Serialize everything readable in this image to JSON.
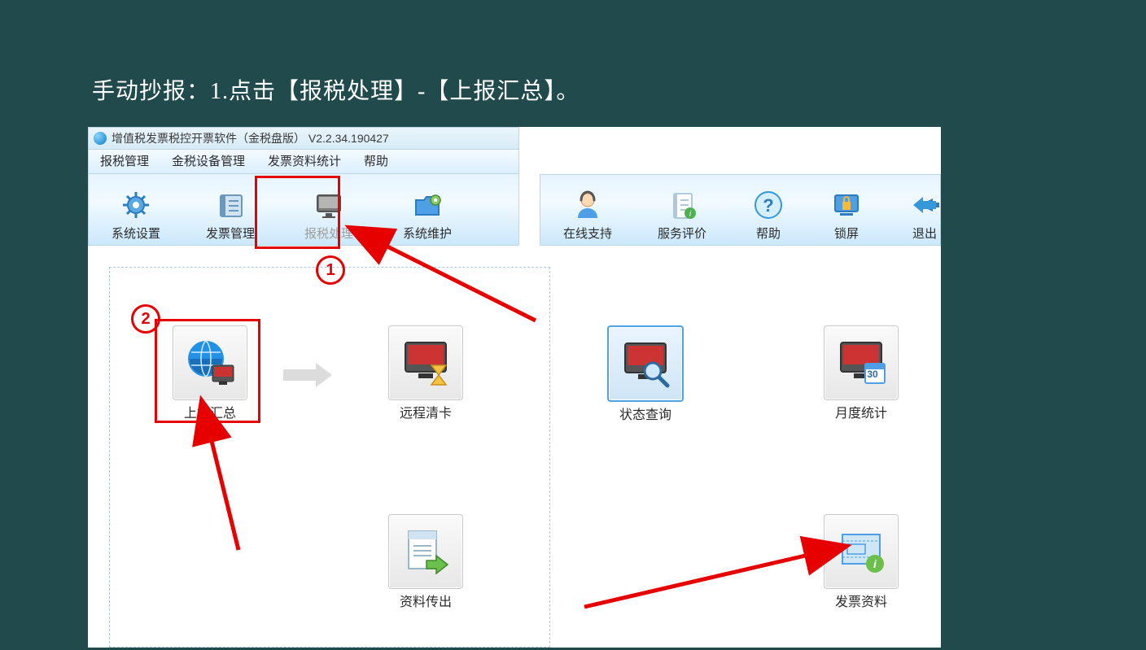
{
  "caption": "手动抄报：1.点击【报税处理】-【上报汇总】。",
  "app_title": "增值税发票税控开票软件（金税盘版） V2.2.34.190427",
  "menus": [
    "报税管理",
    "金税设备管理",
    "发票资料统计",
    "帮助"
  ],
  "toolbar_left": [
    {
      "label": "系统设置",
      "icon": "gear"
    },
    {
      "label": "发票管理",
      "icon": "ledger"
    },
    {
      "label": "报税处理",
      "icon": "monitor"
    },
    {
      "label": "系统维护",
      "icon": "folder-gear"
    }
  ],
  "toolbar_right": [
    {
      "label": "在线支持",
      "icon": "support"
    },
    {
      "label": "服务评价",
      "icon": "notepad"
    },
    {
      "label": "帮助",
      "icon": "help"
    },
    {
      "label": "锁屏",
      "icon": "lock"
    },
    {
      "label": "退出",
      "icon": "back"
    }
  ],
  "funcs": {
    "upload": "上报汇总",
    "remote": "远程清卡",
    "status": "状态查询",
    "month": "月度统计",
    "export": "资料传出",
    "invoice": "发票资料"
  },
  "anno": {
    "step1": "1",
    "step2": "2"
  },
  "month_badge": "30"
}
